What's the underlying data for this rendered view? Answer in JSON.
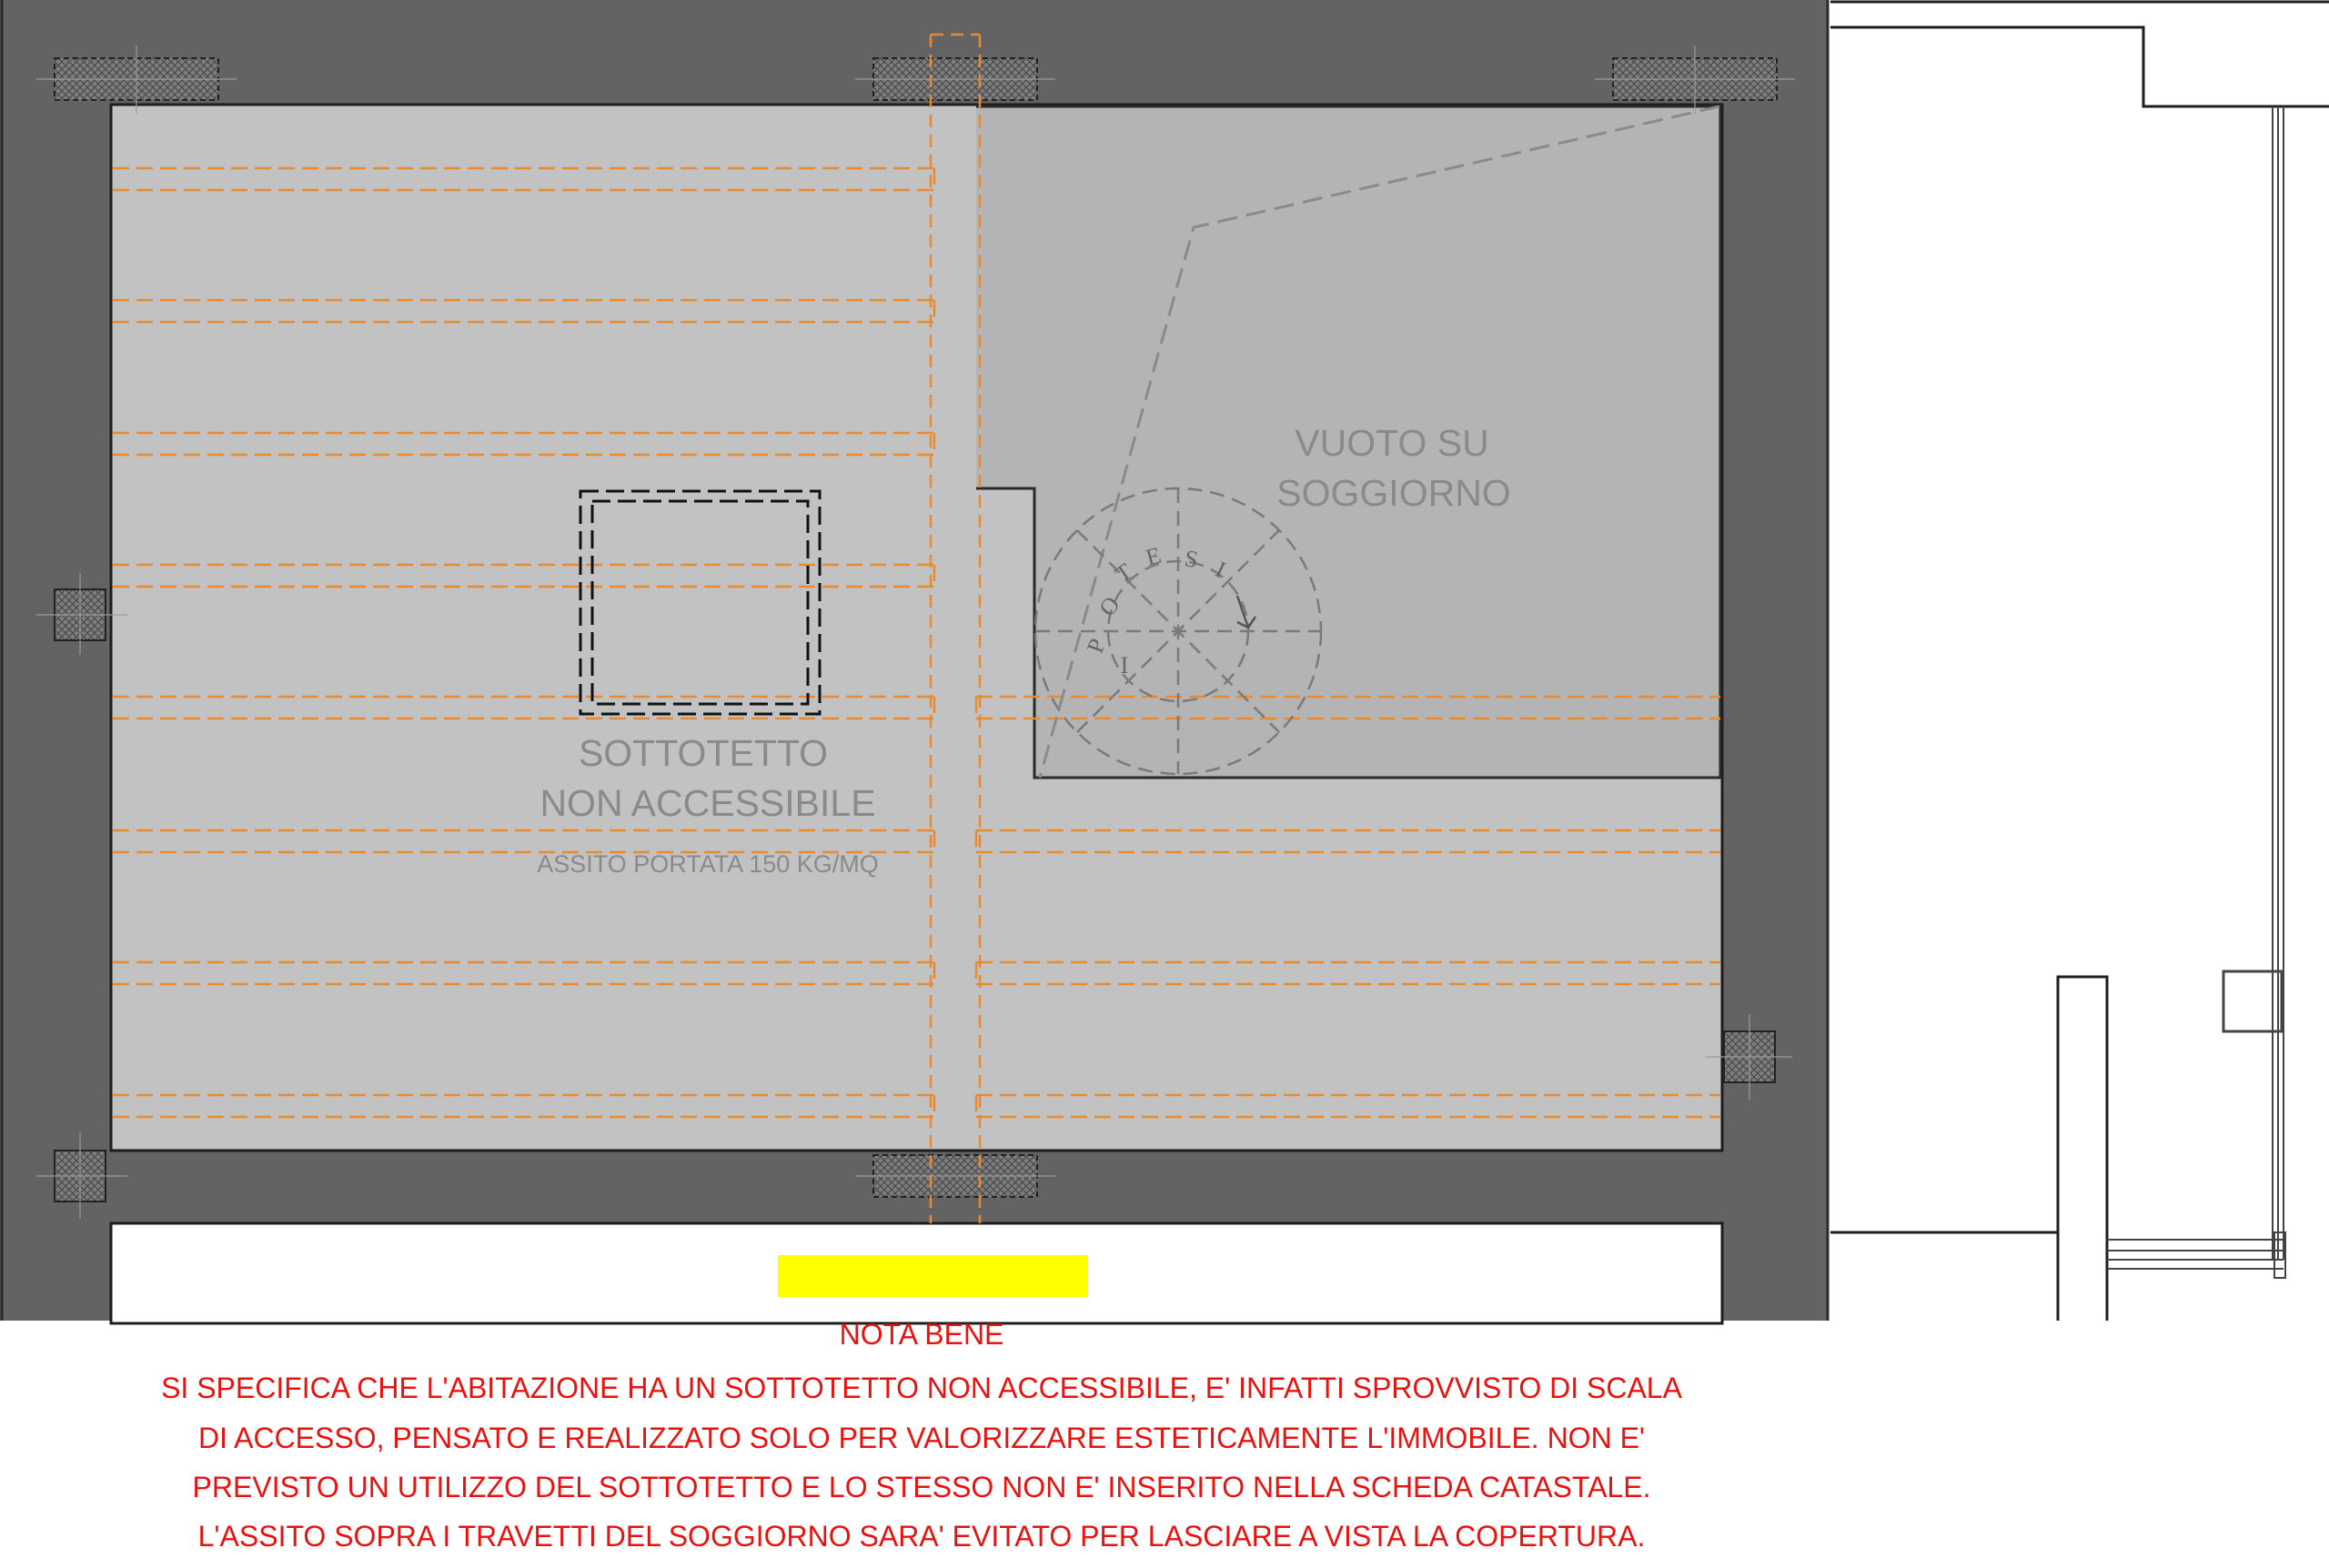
{
  "colors": {
    "wall": "#636363",
    "attic_floor": "#c2c2c3",
    "void_area": "#b4b4b5",
    "joist": "#ea8a2e",
    "note_text": "#e8130f",
    "highlight": "#ffff00",
    "label_text": "#8a8a8a"
  },
  "labels": {
    "attic_line1": "SOTTOTETTO",
    "attic_line2": "NON ACCESSIBILE",
    "attic_sub": "ASSITO PORTATA 150 KG/MQ",
    "void_line1": "VUOTO SU",
    "void_line2": "SOGGIORNO"
  },
  "stair_letters": [
    "I",
    "P",
    "O",
    "T",
    "E",
    "S",
    "I"
  ],
  "note": {
    "title": "NOTA BENE",
    "lines": [
      "SI SPECIFICA CHE L'ABITAZIONE HA UN  SOTTOTETTO NON ACCESSIBILE, E' INFATTI SPROVVISTO DI SCALA",
      "DI  ACCESSO,  PENSATO  E  REALIZZATO  SOLO  PER  VALORIZZARE  ESTETICAMENTE  L'IMMOBILE.  NON  E'",
      "PREVISTO UN UTILIZZO DEL SOTTOTETTO E LO STESSO NON E' INSERITO NELLA SCHEDA CATASTALE.",
      "L'ASSITO SOPRA I TRAVETTI DEL SOGGIORNO SARA' EVITATO PER LASCIARE A VISTA LA COPERTURA."
    ]
  }
}
